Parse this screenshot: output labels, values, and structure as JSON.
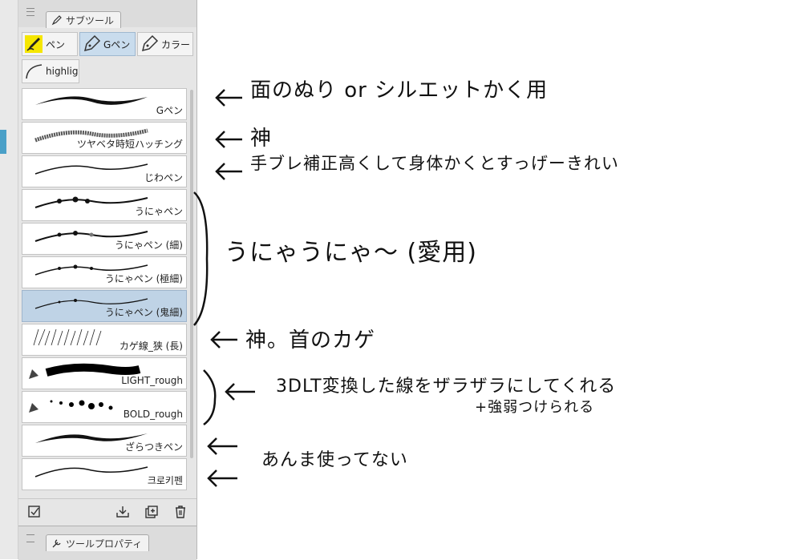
{
  "panel": {
    "title": "サブツール",
    "bottom_title": "ツールプロパティ",
    "tabs": [
      {
        "label": "ペン",
        "active": false
      },
      {
        "label": "Gペン",
        "active": true
      },
      {
        "label": "カラー",
        "active": false
      },
      {
        "label": "highlig",
        "active": false
      }
    ],
    "brushes": [
      {
        "label": "Gペン"
      },
      {
        "label": "ツヤベタ時短ハッチング"
      },
      {
        "label": "じわペン"
      },
      {
        "label": "うにゃペン"
      },
      {
        "label": "うにゃペン (細)"
      },
      {
        "label": "うにゃペン (極細)"
      },
      {
        "label": "うにゃペン (鬼細)",
        "selected": true
      },
      {
        "label": "カゲ線_狭 (長)"
      },
      {
        "label": "LIGHT_rough"
      },
      {
        "label": "BOLD_rough"
      },
      {
        "label": "ざらつきペン"
      },
      {
        "label": "크로키펜"
      }
    ]
  },
  "notes": {
    "n1": "面のぬり or シルエットかく用",
    "n2": "神",
    "n3": "手ブレ補正高くして身体かくとすっげーきれい",
    "n4": "うにゃうにゃ〜 (愛用)",
    "n5": "神。首のカゲ",
    "n6": "3DLT変換した線をザラザラにしてくれる",
    "n6b": "+強弱つけられる",
    "n7": "あんま使ってない"
  },
  "colors": {
    "accent": "#c9dced",
    "selected": "#bfd3e6",
    "highlight": "#f5e600"
  }
}
